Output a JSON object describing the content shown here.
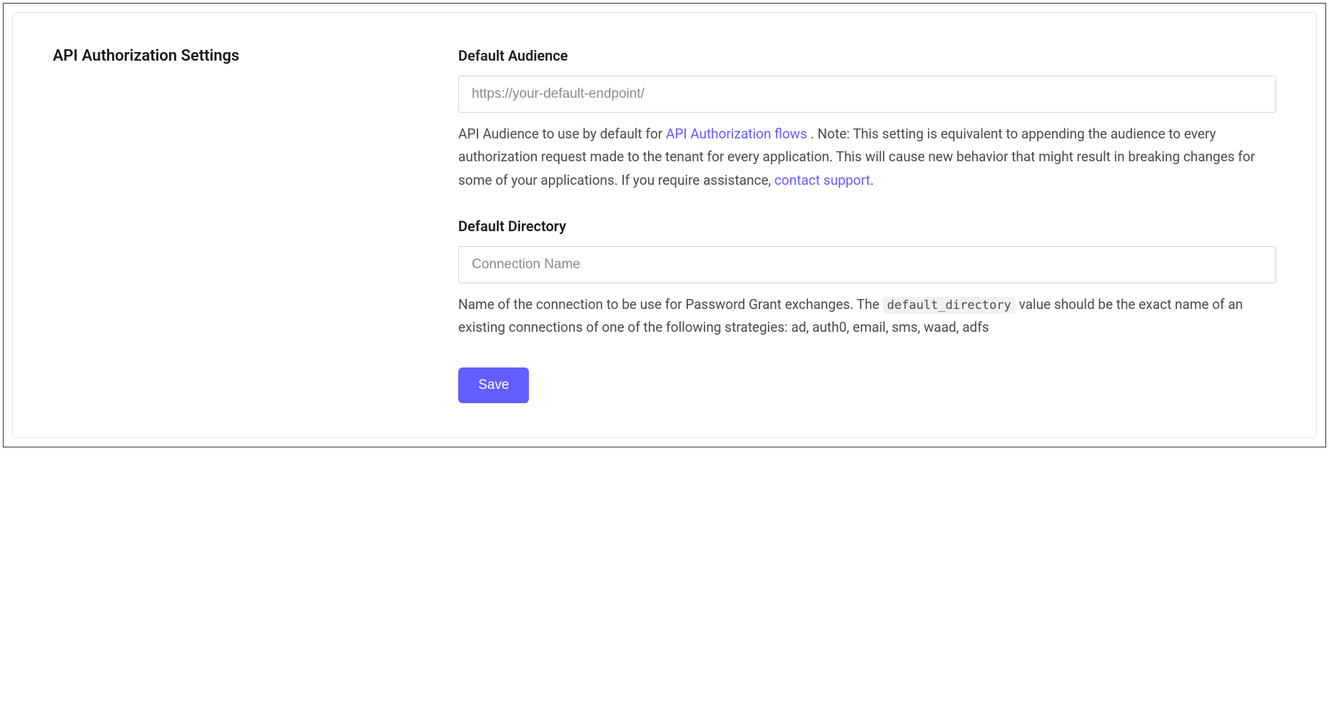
{
  "section": {
    "title": "API Authorization Settings"
  },
  "fields": {
    "default_audience": {
      "label": "Default Audience",
      "placeholder": "https://your-default-endpoint/",
      "value": "",
      "help_pre": "API Audience to use by default for ",
      "help_link1_text": "API Authorization flows",
      "help_mid": " . Note: This setting is equivalent to appending the audience to every authorization request made to the tenant for every application. This will cause new behavior that might result in breaking changes for some of your applications. If you require assistance, ",
      "help_link2_text": "contact support",
      "help_post": "."
    },
    "default_directory": {
      "label": "Default Directory",
      "placeholder": "Connection Name",
      "value": "",
      "help_pre": "Name of the connection to be use for Password Grant exchanges. The ",
      "help_code": "default_directory",
      "help_post": " value should be the exact name of an existing connections of one of the following strategies: ad, auth0, email, sms, waad, adfs"
    }
  },
  "actions": {
    "save_label": "Save"
  }
}
